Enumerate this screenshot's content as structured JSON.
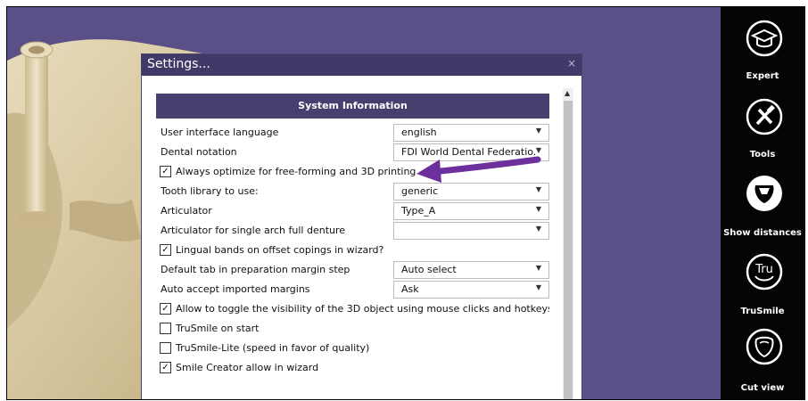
{
  "dialog": {
    "title": "Settings...",
    "close_glyph": "×"
  },
  "section_title": "System Information",
  "settings": [
    {
      "type": "combo",
      "label": "User interface language",
      "value": "english"
    },
    {
      "type": "combo",
      "label": "Dental notation",
      "value": "FDI World Dental Federatio..."
    },
    {
      "type": "check",
      "label": "Always optimize for free-forming and 3D printing",
      "checked": true
    },
    {
      "type": "combo",
      "label": "Tooth library to use:",
      "value": "generic"
    },
    {
      "type": "combo",
      "label": "Articulator",
      "value": "Type_A"
    },
    {
      "type": "combo",
      "label": "Articulator for single arch full denture",
      "value": ""
    },
    {
      "type": "check",
      "label": "Lingual bands on offset copings in wizard?",
      "checked": true
    },
    {
      "type": "combo",
      "label": "Default tab in preparation margin step",
      "value": "Auto select"
    },
    {
      "type": "combo",
      "label": "Auto accept imported margins",
      "value": "Ask"
    },
    {
      "type": "check",
      "label": "Allow to toggle the visibility of the 3D object using mouse clicks and hotkeys",
      "checked": true
    },
    {
      "type": "check",
      "label": "TruSmile on start",
      "checked": false
    },
    {
      "type": "check",
      "label": "TruSmile-Lite (speed in favor of quality)",
      "checked": false
    },
    {
      "type": "check",
      "label": "Smile Creator allow in wizard",
      "checked": true
    }
  ],
  "tools": [
    {
      "label": "Expert",
      "icon": "graduation-cap-icon"
    },
    {
      "label": "Tools",
      "icon": "hammer-wrench-icon"
    },
    {
      "label": "Show distances",
      "icon": "tooth-distance-icon"
    },
    {
      "label": "TruSmile",
      "icon": "trusmile-icon",
      "icon_text": "Tru"
    },
    {
      "label": "Cut view",
      "icon": "tooth-cut-icon"
    }
  ],
  "colors": {
    "background": "#5a4f86",
    "dialog_title": "#3f3a68",
    "section_header": "#46406f",
    "model": "#d9c9a2",
    "toolbar": "#050505",
    "annotation_arrow": "#6c2f9c"
  }
}
